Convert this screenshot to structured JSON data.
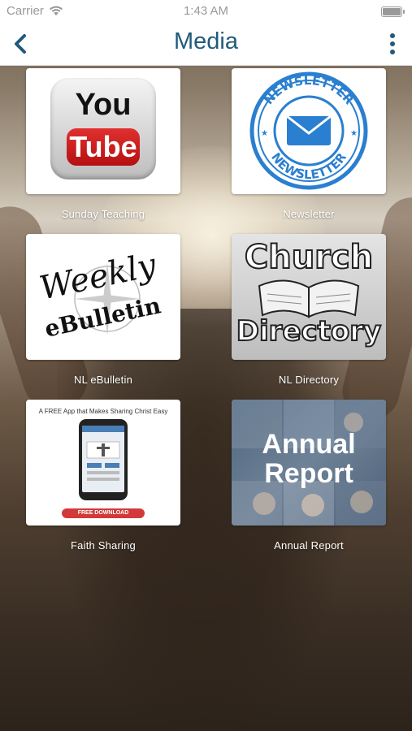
{
  "status": {
    "carrier": "Carrier",
    "time": "1:43 AM"
  },
  "nav": {
    "title": "Media"
  },
  "tiles": [
    {
      "label": "Sunday Teaching",
      "thumb_text": [
        "You",
        "Tube"
      ]
    },
    {
      "label": "Newsletter",
      "thumb_text": [
        "NEWSLETTER",
        "NEWSLETTER"
      ]
    },
    {
      "label": "NL eBulletin",
      "thumb_text": [
        "Weekly",
        "eBulletin"
      ]
    },
    {
      "label": "NL Directory",
      "thumb_text": [
        "Church",
        "Directory"
      ]
    },
    {
      "label": "Faith Sharing",
      "thumb_text": [
        "A FREE App that Makes Sharing Christ Easy",
        "FREE DOWNLOAD"
      ]
    },
    {
      "label": "Annual Report",
      "thumb_text": [
        "Annual",
        "Report"
      ]
    }
  ],
  "colors": {
    "nav_title": "#1f5a7a",
    "accent": "#1f5a7a",
    "newsletter_blue": "#2a7fd0",
    "youtube_red": "#c81e1e"
  }
}
